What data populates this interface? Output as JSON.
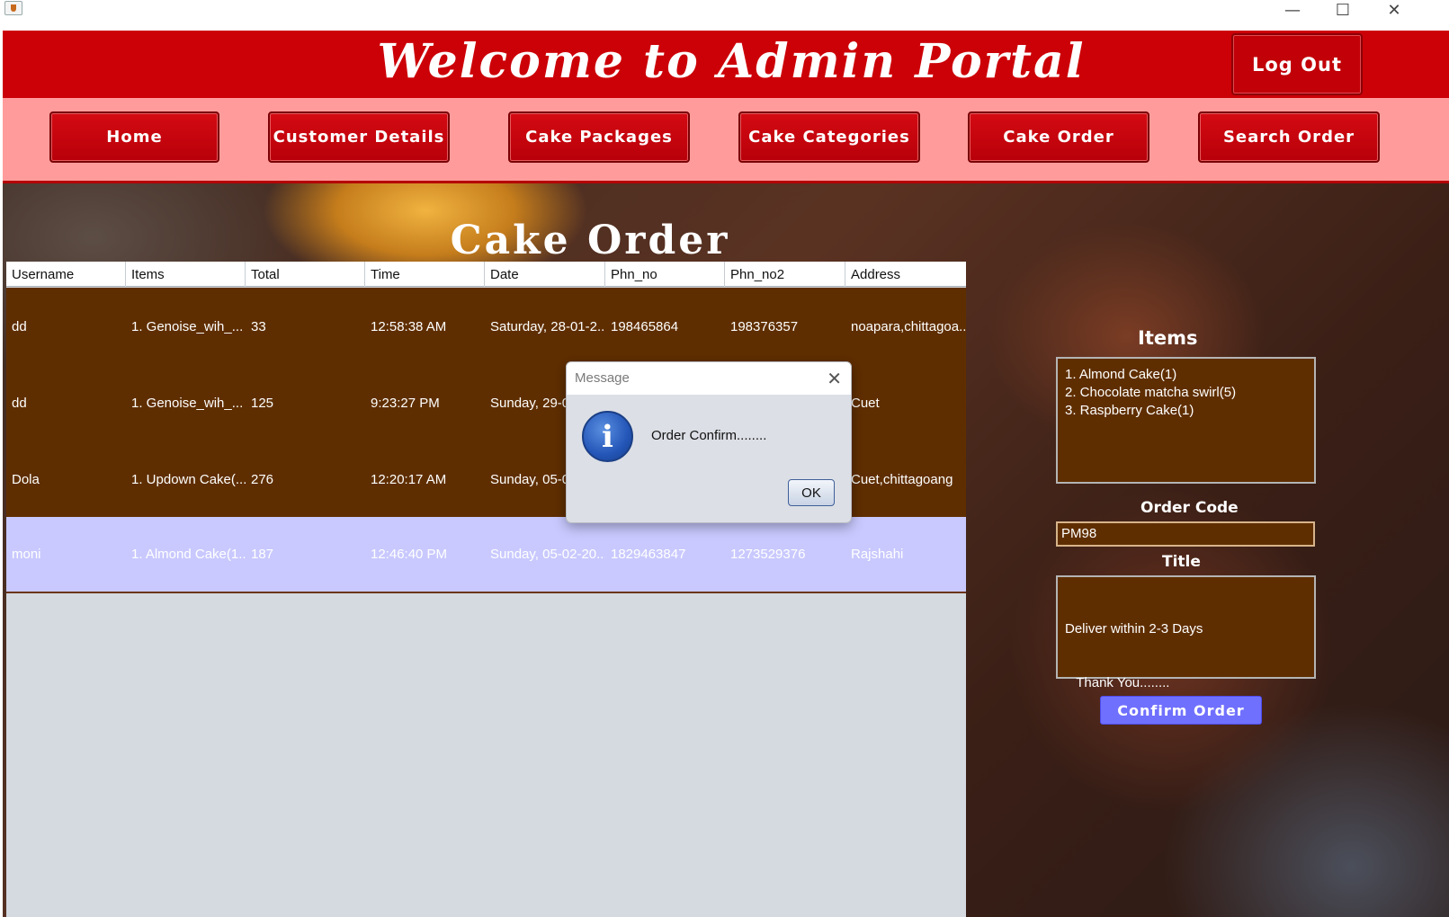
{
  "window": {
    "minimize_glyph": "—",
    "maximize_glyph": "☐",
    "close_glyph": "✕"
  },
  "header": {
    "title": "Welcome to  Admin Portal",
    "logout_label": "Log Out"
  },
  "nav": {
    "items": [
      {
        "label": "Home"
      },
      {
        "label": "Customer Details"
      },
      {
        "label": "Cake Packages"
      },
      {
        "label": "Cake Categories"
      },
      {
        "label": "Cake Order"
      },
      {
        "label": "Search Order"
      }
    ]
  },
  "page_title": "Cake Order",
  "table": {
    "columns": [
      "Username",
      "Items",
      "Total",
      "Time",
      "Date",
      "Phn_no",
      "Phn_no2",
      "Address"
    ],
    "rows": [
      {
        "username": "dd",
        "items": "1. Genoise_wih_...",
        "total": "33",
        "time": "12:58:38 AM",
        "date": "Saturday, 28-01-2...",
        "phn_no": "198465864",
        "phn_no2": "198376357",
        "address": "noapara,chittagoa..."
      },
      {
        "username": "dd",
        "items": "1. Genoise_wih_...",
        "total": "125",
        "time": "9:23:27 PM",
        "date": "Sunday, 29-0",
        "phn_no": "",
        "phn_no2": "",
        "address": "Cuet"
      },
      {
        "username": "Dola",
        "items": "1. Updown Cake(...",
        "total": "276",
        "time": "12:20:17 AM",
        "date": "Sunday, 05-0",
        "phn_no": "",
        "phn_no2": "",
        "address": "Cuet,chittagoang"
      },
      {
        "username": "moni",
        "items": "1. Almond Cake(1...",
        "total": "187",
        "time": "12:46:40 PM",
        "date": "Sunday, 05-02-20...",
        "phn_no": "1829463847",
        "phn_no2": "1273529376",
        "address": "Rajshahi"
      }
    ]
  },
  "side_panel": {
    "items_label": "Items",
    "items": [
      "1. Almond Cake(1)",
      "2. Chocolate matcha swirl(5)",
      "3. Raspberry Cake(1)"
    ],
    "order_code_label": "Order Code",
    "order_code_value": "PM98",
    "title_label": "Title",
    "title_lines": [
      "Deliver within 2-3 Days",
      "   Thank You........"
    ],
    "confirm_label": "Confirm Order"
  },
  "dialog": {
    "title": "Message",
    "message": "Order Confirm........",
    "ok_label": "OK",
    "icon": "info-icon"
  },
  "colors": {
    "header_red": "#cc0007",
    "nav_pink": "#ff9c9b",
    "row_brown": "#5f2e00",
    "selected_row": "#c9c9ff",
    "confirm_blue": "#7070ff"
  }
}
